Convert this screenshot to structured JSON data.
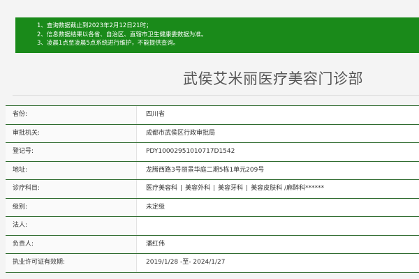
{
  "notice": {
    "lines": [
      "1、查询数据截止到2023年2月12日21时；",
      "2、信息数据结果以各省、自治区、直辖市卫生健康委数据为准。",
      "3、凌晨1点至凌晨5点系统进行维护，不能提供查询。"
    ]
  },
  "title": "武侯艾米丽医疗美容门诊部",
  "rows": [
    {
      "label": "省份:",
      "value": "四川省"
    },
    {
      "label": "审批机关:",
      "value": "成都市武侯区行政审批局"
    },
    {
      "label": "登记号:",
      "value": "PDY10002951010717D1542"
    },
    {
      "label": "地址:",
      "value": "龙腾西路3号丽景华庭二期5栋1单元209号"
    },
    {
      "label": "诊疗科目:",
      "value": "",
      "subjects": [
        "医疗美容科",
        "美容外科",
        "美容牙科",
        "美容皮肤科 /麻醉科******"
      ]
    },
    {
      "label": "级别:",
      "value": "未定级"
    },
    {
      "label": "法人:",
      "value": ""
    },
    {
      "label": "负责人:",
      "value": "潘红伟"
    },
    {
      "label": "执业许可证有效期:",
      "value": "2019/1/28 -至- 2024/1/27"
    }
  ]
}
